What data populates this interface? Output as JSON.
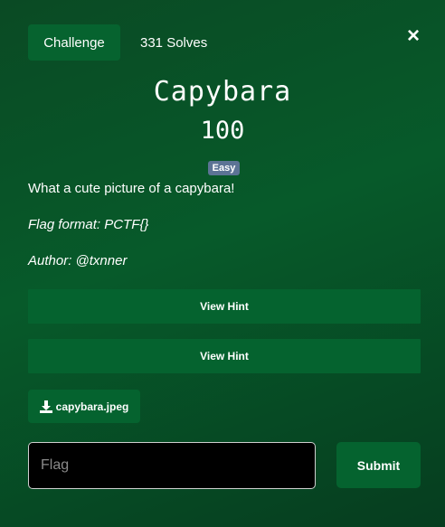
{
  "tabs": {
    "challenge_label": "Challenge",
    "solves_label": "331 Solves"
  },
  "close_glyph": "×",
  "challenge": {
    "title": "Capybara",
    "points": "100",
    "difficulty": "Easy",
    "description": "What a cute picture of a capybara!",
    "flag_format": "Flag format: PCTF{}",
    "author": "Author: @txnner"
  },
  "hints": [
    {
      "label": "View Hint"
    },
    {
      "label": "View Hint"
    }
  ],
  "file": {
    "name": "capybara.jpeg",
    "icon": "download-icon"
  },
  "flag_input": {
    "placeholder": "Flag",
    "value": ""
  },
  "submit_label": "Submit",
  "colors": {
    "background": "#075a2a",
    "button": "#05632f",
    "badge": "#5c7395",
    "input_bg": "#000000"
  }
}
